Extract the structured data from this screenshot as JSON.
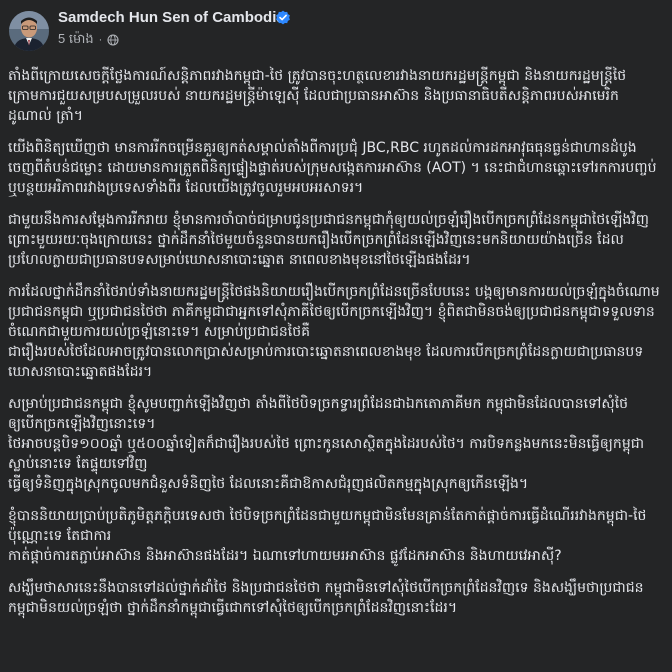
{
  "header": {
    "author_name": "Samdech Hun Sen of Cambodia",
    "timestamp": "5 ម៉ោង",
    "privacy_icon": "globe-icon",
    "verified_icon": "verified-badge-icon"
  },
  "colors": {
    "background": "#242526",
    "text": "#e4e6eb",
    "secondary_text": "#b0b3b8",
    "verified": "#2d88ff"
  },
  "post": {
    "paragraphs": [
      "តាំងពីក្រោយសេចក្ដីថ្លែងការណ៍សន្តិភាពរវាងកម្ពុជា-ថៃ ត្រូវបានចុះហត្ថលេខារវាងនាយករដ្ឋមន្ត្រីកម្ពុជា និងនាយករដ្ឋមន្ត្រីថៃ ក្រោមការជួយសម្របសម្រួលរបស់ នាយករដ្ឋមន្ត្រីម៉ាឡេស៊ី ដែលជាប្រធានអាស៊ាន និងប្រធានាធិបតីសន្តិភាពរបស់អាមេរិក ដូណាល់ ត្រាំ។",
      "យើងពិនិត្យឃើញថា មានការរីកចម្រើនគួរឲ្យកត់សម្គាល់តាំងពីការប្រជុំ JBC,RBC រហូតដល់ការដកអាវុធធុនធ្ងន់ជាហានដំបូងចេញពីតំបន់ជម្លោះ ដោយមានការត្រួតពិនិត្យផ្ទៀងផ្ទាត់របស់ក្រុមសង្កេតការអាស៊ាន (AOT) ។ នេះជាជំហានឆ្ពោះទៅរកការបញ្ចប់ ឬបន្ថយអរិភាពរវាងប្រទេសទាំងពីរ ដែលយើងត្រូវចូលរួមអបអរសាទរ។",
      "ជាមួយនឹងការសម្ដែងការរីករាយ ខ្ញុំមានការចាំបាច់ជម្រាបជូនប្រជាជនកម្ពុជាកុំឲ្យយល់ច្រឡំរឿងបើកច្រកព្រំដែនកម្ពុជាថៃឡើងវិញ ព្រោះមួយរយៈចុងក្រោយនេះ ថ្នាក់ដឹកនាំថៃមួយចំនួនបានយករឿងបើកច្រកព្រំដែនឡើងវិញនេះមកនិយាយយ៉ាងច្រើន ដែលប្រហែលក្លាយជាប្រធានបទសម្រាប់ឃោសនាបោះឆ្នោត នាពេលខាងមុខនៅថៃឡើងផងដែរ។",
      "ការដែលថ្នាក់ដឹកនាំថៃរាប់ទាំងនាយករដ្ឋមន្ត្រីថៃផងនិយាយរឿងបើកច្រកព្រំដែនច្រើនបែបនេះ បង្កឲ្យមានការយល់ច្រឡំក្នុងចំណោមប្រជាជនកម្ពុជា ឬប្រជាជនថៃថា ភាគីកម្ពុជាជាអ្នកទៅសុំភាគីថៃឲ្យបើកច្រកឡើងវិញ។ ខ្ញុំពិតជាមិនចង់ឲ្យប្រជាជនកម្ពុជាទទួលទានចំណេកជាមួយការយល់ច្រឡំនោះទេ។ សម្រាប់ប្រជាជនថៃគឺ\nជារឿងរបស់ថៃដែលអាចត្រូវបានលោកប្រាស់សម្រាប់ការបោះឆ្នោតនាពេលខាងមុខ ដែលការបើកច្រកព្រំដែនក្លាយជាប្រធានបទឃោសនាបោះឆ្នោតផងដែរ។",
      "សម្រាប់ប្រជាជនកម្ពុជា ខ្ញុំសូមបញ្ជាក់ឡើងវិញថា តាំងពីថៃបិទច្រកទ្វារព្រំដែនជាឯកតោភាគីមក កម្ពុជាមិនដែលបានទៅសុំថៃឲ្យបើកច្រកឡើងវិញនោះទេ។\nថៃអាចបន្តបិទ១០០ឆ្នាំ ឬ៥០០ឆ្នាំទៀតក៏ជារឿងរបស់ថៃ ព្រោះកូនសោស្ថិតក្នុងដៃរបស់ថៃ។ ការបិទកន្លងមកនេះមិនធ្វើឲ្យកម្ពុជាស្លាប់នោះទេ តែផ្ទុយទៅវិញ\nធ្វើឲ្យទំនិញក្នុងស្រុកចូលមកជំនួសទំនិញថៃ ដែលនោះគឺជាឱកាសជំរុញផលិតកម្មក្នុងស្រុកឲ្យកើនឡើង។",
      "ខ្ញុំបាននិយាយប្រាប់ប្រតិភូមិត្តភក្តិបរទេសថា ថៃបិទច្រកព្រំដែនជាមួយកម្ពុជាមិនមែនគ្រាន់តែកាត់ផ្ដាច់ការធ្វើដំណើររវាងកម្ពុជា-ថៃប៉ុណ្ណោះទេ តែជាការ\nកាត់ផ្ដាច់ការតភ្ជាប់អាស៊ាន និងអាស៊ានផងដែរ។ ឯណាទៅហាយមរអាស៊ាន ផ្លូវដែកអាស៊ាន និងហាយវេអាស៊ី?",
      "សង្ឃឹមថាសារនេះនឹងបានទៅដល់ថ្នាក់ដាំថៃ និងប្រជាជនថៃថា កម្ពុជាមិនទៅសុំថៃបើកច្រកព្រំដែនវិញទេ និងសង្ឃឹមថាប្រជាជនកម្ពុជាមិនយល់ច្រឡំថា ថ្នាក់ដឹកនាំកម្ពុជាធ្វើជោកទៅសុំថៃឲ្យបើកច្រកព្រំដែនវិញនោះដែរ។"
    ]
  }
}
